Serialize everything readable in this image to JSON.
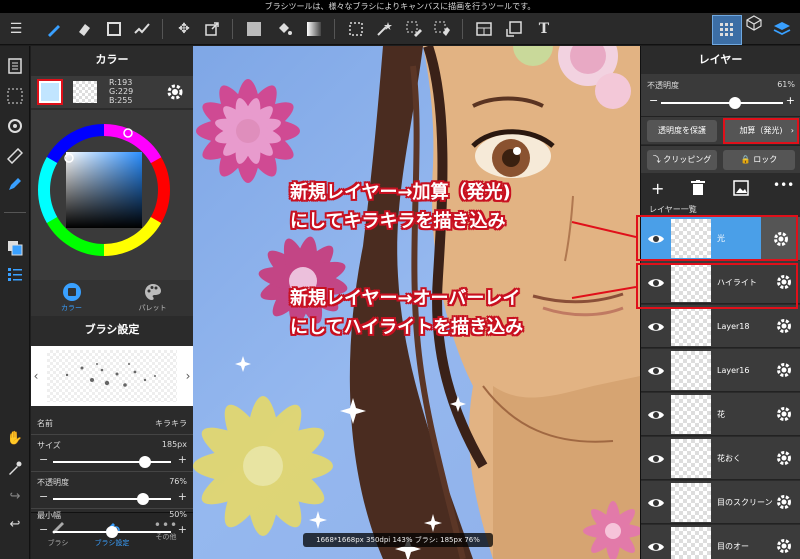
{
  "status_bar": {
    "hint": "ブラシツールは、様々なブラシによりキャンバスに描画を行うツールです。"
  },
  "color_panel": {
    "title": "カラー",
    "rgb": {
      "r": "R:193",
      "g": "G:229",
      "b": "B:255"
    },
    "primary_color": "#c1e5ff",
    "tabs": [
      {
        "label": "カラー"
      },
      {
        "label": "パレット"
      }
    ]
  },
  "brush_settings": {
    "title": "ブラシ設定",
    "name_label": "名前",
    "name_value": "キラキラ",
    "size_label": "サイズ",
    "size_value": "185px",
    "size_level": 0.78,
    "opacity_label": "不透明度",
    "opacity_value": "76%",
    "opacity_level": 0.76,
    "min_width_label": "最小幅",
    "min_width_value": "50%",
    "min_width_level": 0.5
  },
  "left_bottom_tabs": [
    {
      "label": "ブラシ"
    },
    {
      "label": "ブラシ設定"
    },
    {
      "label": "その他"
    }
  ],
  "layer_panel": {
    "title": "レイヤー",
    "opacity_label": "不透明度",
    "opacity_value": "61%",
    "opacity_level": 0.61,
    "protect_btn": "透明度を保護",
    "blend_btn": "加算（発光)",
    "clipping_btn": "クリッピング",
    "lock_btn": "ロック",
    "list_title": "レイヤー一覧",
    "layers": [
      {
        "name": "光",
        "selected": true
      },
      {
        "name": "ハイライト",
        "selected": false
      },
      {
        "name": "Layer18",
        "selected": false
      },
      {
        "name": "Layer16",
        "selected": false
      },
      {
        "name": "花",
        "selected": false
      },
      {
        "name": "花おく",
        "selected": false
      },
      {
        "name": "目のスクリーン",
        "selected": false
      },
      {
        "name": "目のオー",
        "selected": false
      }
    ]
  },
  "annotations": {
    "line1a": "新規レイヤー→加算（発光)",
    "line1b": "にしてキラキラを描き込み",
    "line2a": "新規レイヤー→オーバーレイ",
    "line2b": "にしてハイライトを描き込み"
  },
  "canvas_status": "1668*1668px 350dpi 143% ブラシ: 185px 76%",
  "colors": {
    "accent": "#1e88e5",
    "highlight_red": "#e0101a",
    "selected_layer": "#4a9fe8"
  }
}
